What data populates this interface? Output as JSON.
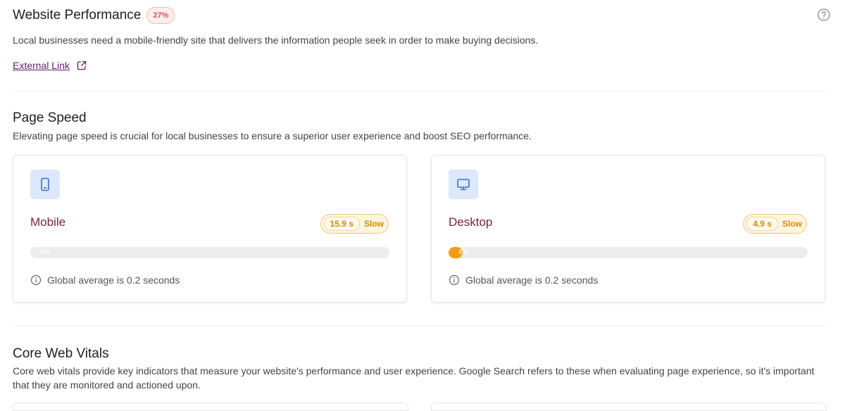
{
  "header": {
    "title": "Website Performance",
    "score": "27%",
    "intro": "Local businesses need a mobile-friendly site that delivers the information people seek in order to make buying decisions.",
    "link_label": "External Link"
  },
  "page_speed": {
    "title": "Page Speed",
    "description": "Elevating page speed is crucial for local businesses to ensure a superior user experience and boost SEO performance.",
    "cards": [
      {
        "label": "Mobile",
        "time": "15.9 s",
        "status": "Slow",
        "progress_percent": 0,
        "progress_text": "0%",
        "average": "Global average is 0.2 seconds"
      },
      {
        "label": "Desktop",
        "time": "4.9 s",
        "status": "Slow",
        "progress_percent": 4,
        "progress_text": "4%",
        "average": "Global average is 0.2 seconds"
      }
    ]
  },
  "core_web_vitals": {
    "title": "Core Web Vitals",
    "description": "Core web vitals provide key indicators that measure your website's performance and user experience. Google Search refers to these when evaluating page experience, so it's important that they are monitored and actioned upon."
  },
  "colors": {
    "accent_link": "#6a1b6e",
    "card_label": "#7a1f3d",
    "slow": "#f39c12",
    "score_bad": "#d9534f",
    "icon_bg": "#dce8fb",
    "icon_stroke": "#3b6fd8"
  },
  "icons": {
    "help": "help-circle-icon",
    "external": "external-link-icon",
    "mobile": "smartphone-icon",
    "desktop": "monitor-icon",
    "info": "info-circle-icon"
  }
}
